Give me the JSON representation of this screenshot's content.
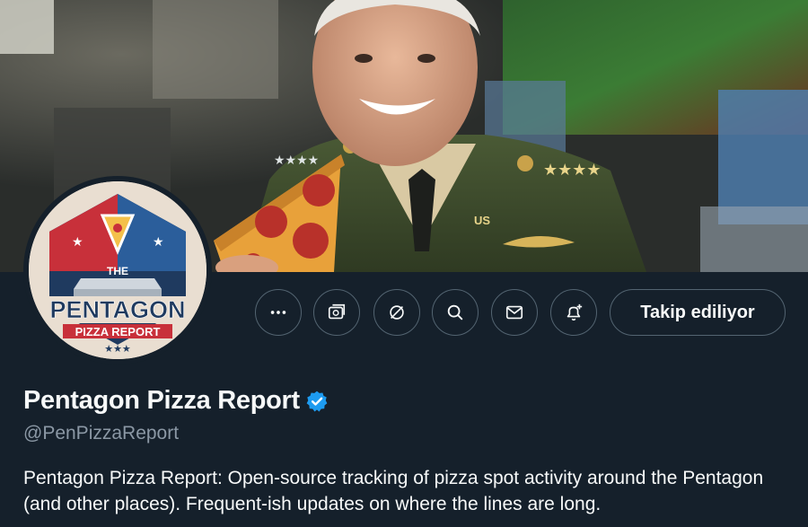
{
  "profile": {
    "display_name": "Pentagon Pizza Report",
    "handle": "@PenPizzaReport",
    "bio": "Pentagon Pizza Report: Open-source tracking of pizza spot activity around the Pentagon (and other places). Frequent-ish updates on where the lines are long.",
    "verified": true
  },
  "avatar": {
    "text_the": "THE",
    "text_pentagon": "PENTAGON",
    "text_sub": "PIZZA REPORT",
    "text_stars": "★★★"
  },
  "banner": {
    "badge_text": "US"
  },
  "actions": {
    "more_icon": "more-icon",
    "subscribe_icon": "subscribe-icon",
    "grok_icon": "grok-icon",
    "search_icon": "search-icon",
    "message_icon": "mail-icon",
    "notify_icon": "bell-plus-icon",
    "follow_label": "Takip ediliyor"
  },
  "colors": {
    "background": "#15202b",
    "border": "#536471",
    "verified": "#1d9bf0",
    "secondary_text": "#8b98a5"
  }
}
